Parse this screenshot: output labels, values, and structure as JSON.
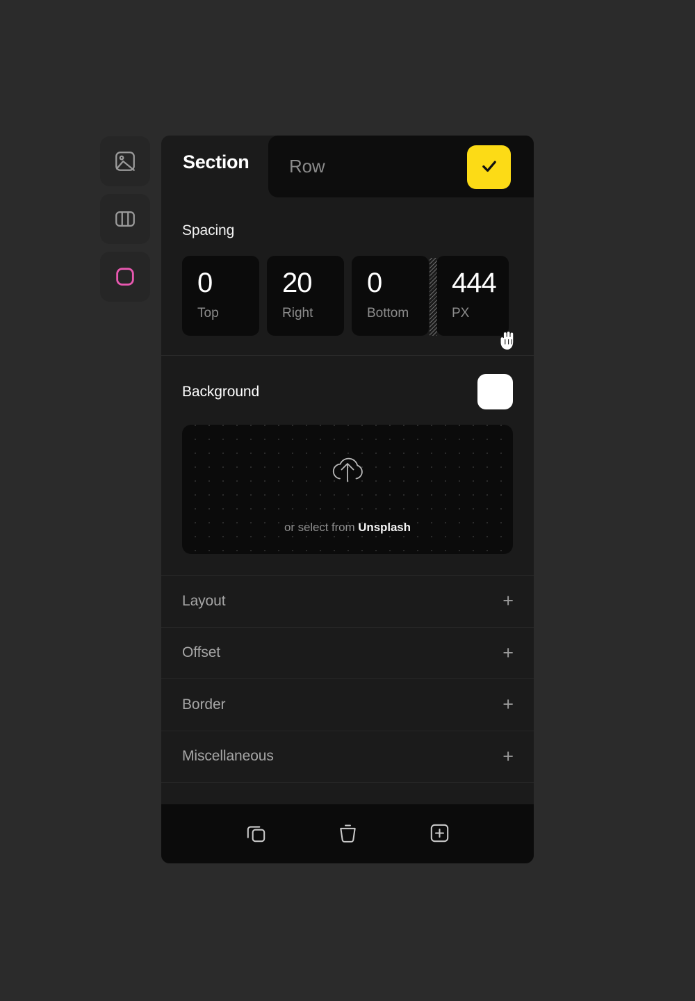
{
  "theme": {
    "page_background": "#2b2b2b",
    "panel_background": "#1b1b1b",
    "field_background": "#0b0b0b",
    "accent_yellow": "#fcdb16",
    "accent_pink": "#e858b0",
    "text_primary": "#ffffff",
    "text_muted": "#8c8c8c"
  },
  "sidebar": {
    "items": [
      {
        "name": "image-tool",
        "icon": "image-icon",
        "active": false
      },
      {
        "name": "columns-tool",
        "icon": "columns-icon",
        "active": false
      },
      {
        "name": "section-tool",
        "icon": "rounded-square-icon",
        "active": true
      }
    ]
  },
  "header": {
    "title": "Section",
    "row_value": "Row",
    "confirm_icon": "check-icon"
  },
  "spacing": {
    "label": "Spacing",
    "fields": [
      {
        "value": "0",
        "unit": "Top"
      },
      {
        "value": "20",
        "unit": "Right"
      },
      {
        "value": "0",
        "unit": "Bottom"
      },
      {
        "value": "444",
        "unit": "PX"
      }
    ]
  },
  "background": {
    "label": "Background",
    "swatch_color": "#ffffff",
    "dropzone": {
      "icon": "cloud-upload-icon",
      "text_prefix": "or select from ",
      "link_text": "Unsplash"
    }
  },
  "accordion": {
    "rows": [
      {
        "label": "Layout",
        "expand_icon": "plus-icon"
      },
      {
        "label": "Offset",
        "expand_icon": "plus-icon"
      },
      {
        "label": "Border",
        "expand_icon": "plus-icon"
      },
      {
        "label": "Miscellaneous",
        "expand_icon": "plus-icon"
      }
    ]
  },
  "toolbar": {
    "buttons": [
      {
        "name": "duplicate-button",
        "icon": "duplicate-icon"
      },
      {
        "name": "delete-button",
        "icon": "trash-icon"
      },
      {
        "name": "add-button",
        "icon": "add-square-icon"
      }
    ]
  },
  "cursor": {
    "type": "grab-hand-cursor"
  }
}
